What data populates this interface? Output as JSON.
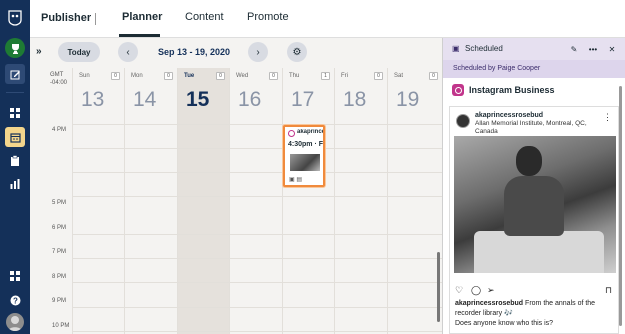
{
  "rail": {
    "icons": [
      "hootsuite-owl-icon",
      "trophy-icon",
      "compose-icon",
      "dashboard-icon",
      "planner-icon",
      "clipboard-icon",
      "analytics-icon",
      "apps-grid-icon",
      "help-icon"
    ]
  },
  "topbar": {
    "product": "Publisher",
    "tabs": [
      {
        "label": "Planner"
      },
      {
        "label": "Content"
      },
      {
        "label": "Promote"
      }
    ]
  },
  "toolbar": {
    "today_label": "Today",
    "prev_icon": "‹",
    "next_icon": "›",
    "range": "Sep 13 - 19, 2020",
    "settings_icon": "⚙"
  },
  "calendar": {
    "timezone_line1": "GMT",
    "timezone_line2": "-04:00",
    "days": [
      {
        "name": "Sun",
        "num": "13",
        "count": "0"
      },
      {
        "name": "Mon",
        "num": "14",
        "count": "0"
      },
      {
        "name": "Tue",
        "num": "15",
        "count": "0"
      },
      {
        "name": "Wed",
        "num": "16",
        "count": "0"
      },
      {
        "name": "Thu",
        "num": "17",
        "count": "1"
      },
      {
        "name": "Fri",
        "num": "18",
        "count": "0"
      },
      {
        "name": "Sat",
        "num": "19",
        "count": "0"
      }
    ],
    "times": [
      "4 PM",
      "5 PM",
      "6 PM",
      "7 PM",
      "8 PM",
      "9 PM",
      "10 PM"
    ],
    "post": {
      "account": "akaprincessrosebud",
      "time": "4:30pm · F"
    }
  },
  "panel": {
    "status": "Scheduled",
    "scheduled_by": "Scheduled by Paige Cooper",
    "network": "Instagram Business",
    "preview": {
      "username": "akaprincessrosebud",
      "location": "Allan Memorial Institute, Montreal, QC, Canada",
      "caption_user": "akaprincessrosebud",
      "caption_text": " From the annals of the recorder library 🎶",
      "caption_line2": "Does anyone know who this is?"
    }
  },
  "colors": {
    "rail": "#143059",
    "accent_orange": "#f08a3c",
    "panel_header": "#e6e0f0",
    "instagram": "#c1358b"
  }
}
